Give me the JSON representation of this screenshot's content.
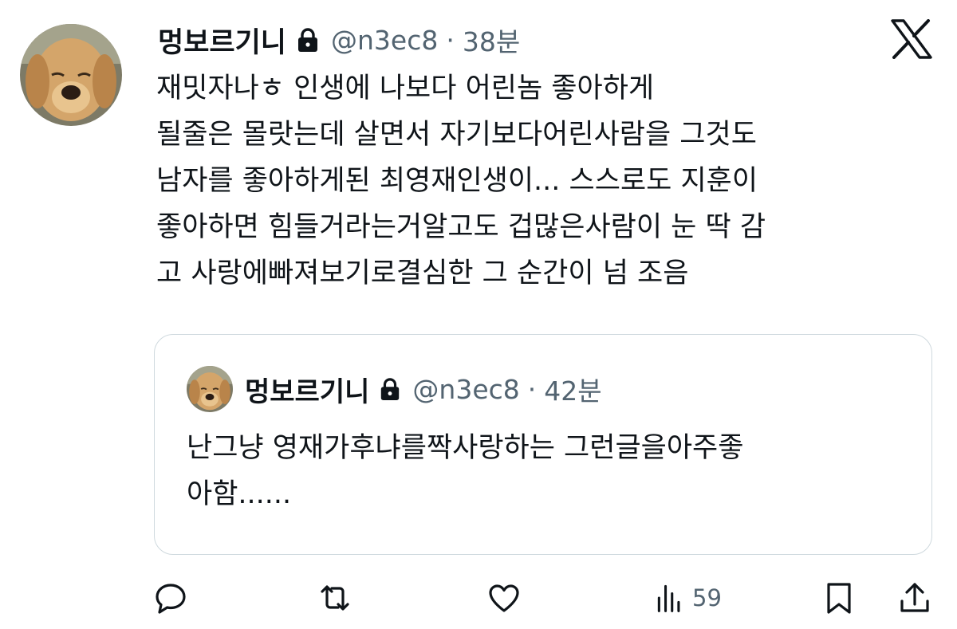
{
  "author": {
    "name": "멍보르기니",
    "handle": "@n3ec8",
    "time": "38분",
    "separator": "·",
    "protected": true
  },
  "tweet": {
    "lines": [
      "재밋자나ㅎ 인생에 나보다 어린놈 좋아하게",
      "될줄은 몰랏는데 살면서 자기보다어린사람을 그것도",
      "남자를 좋아하게된 최영재인생이... 스스로도 지훈이",
      "좋아하면 힘들거라는거알고도 겁많은사람이 눈 딱 감",
      "고 사랑에빠져보기로결심한 그 순간이 넘 조음"
    ]
  },
  "quote": {
    "name": "멍보르기니",
    "handle": "@n3ec8",
    "time": "42분",
    "separator": "·",
    "lines": [
      "난그냥 영재가후냐를짝사랑하는 그런글을아주좋",
      "아함......"
    ]
  },
  "actions": {
    "views_count": "59"
  },
  "icons": {
    "brand": "x-logo-icon",
    "protected": "lock-icon",
    "reply": "reply-icon",
    "retweet": "retweet-icon",
    "like": "heart-icon",
    "views": "views-icon",
    "bookmark": "bookmark-icon",
    "share": "share-icon"
  },
  "colors": {
    "text": "#0f1419",
    "secondary": "#536471",
    "border": "#cfd9de"
  }
}
